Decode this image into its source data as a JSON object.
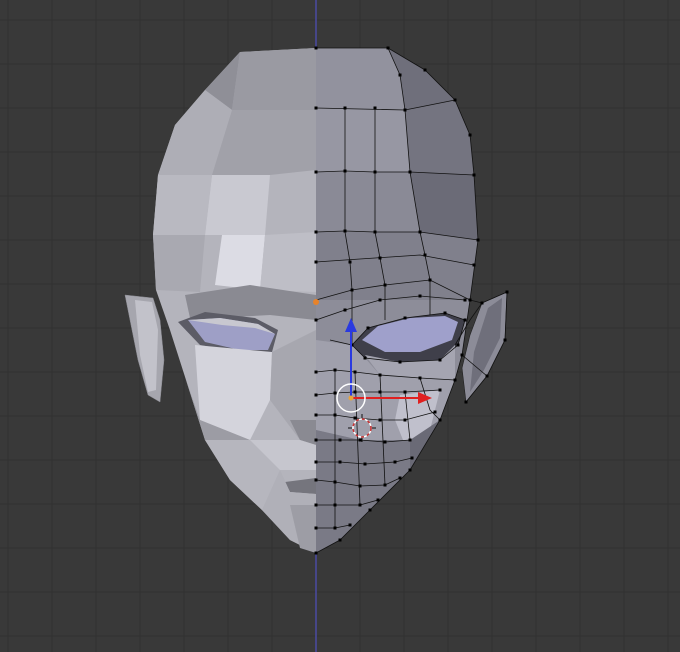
{
  "viewport": {
    "background": "#393939",
    "grid_color": "#313131",
    "axis_color": "#4b4ba3"
  },
  "mesh": {
    "left_half_shading": "flat",
    "right_half_shading": "edit-wireframe",
    "vertex_color": "#000000",
    "selected_vertex_color": "#e8832a"
  },
  "gizmo": {
    "x_color": "#e02020",
    "z_color": "#2a3ae0",
    "pivot_color": "#ffffff"
  },
  "cursor_3d": {
    "color": "#cc3333"
  }
}
